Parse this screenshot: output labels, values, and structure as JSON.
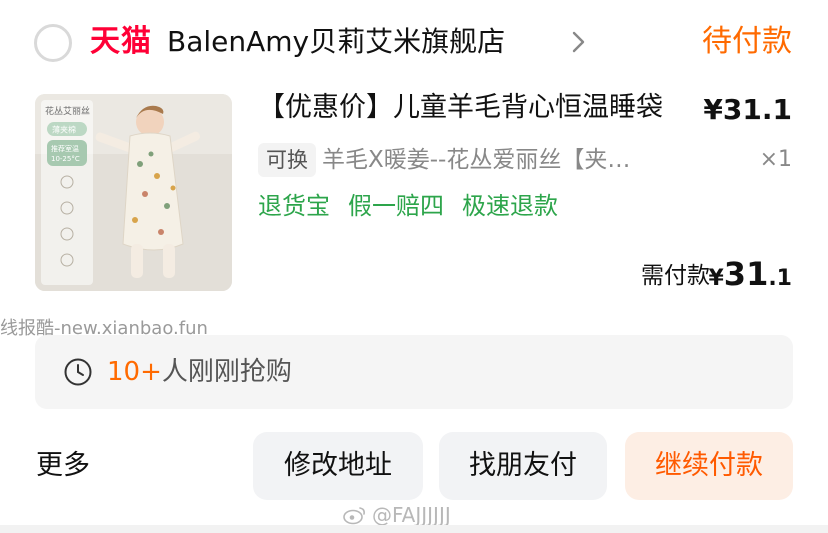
{
  "shop": {
    "platform_logo": "天猫",
    "name": "BalenAmy贝莉艾米旗舰店",
    "status": "待付款"
  },
  "item": {
    "thumbnail": {
      "brand_text": "花丛艾丽丝",
      "badge_text": "薄夹棉",
      "temp_label": "推荐室温",
      "temp_range": "10-25°C"
    },
    "title": "【优惠价】儿童羊毛背心恒温睡袋",
    "price": "¥31.1",
    "exchange_tag": "可换",
    "sku": "羊毛X暖姜--花丛爱丽丝【夹…",
    "quantity": "×1",
    "services": [
      "退货宝",
      "假一赔四",
      "极速退款"
    ],
    "pay_label": "需付款",
    "pay_currency": "¥",
    "pay_integer": "31",
    "pay_decimal": ".1"
  },
  "watermark_top": "线报酷-new.xianbao.fun",
  "buyers": {
    "icon": "clock-icon",
    "highlight": "10+",
    "text": "人刚刚抢购"
  },
  "actions": {
    "more": "更多",
    "modify_address": "修改地址",
    "friend_pay": "找朋友付",
    "continue_pay": "继续付款"
  },
  "watermark_bottom": "@FAJJJJJJ",
  "colors": {
    "brand_red": "#ff0036",
    "status_orange": "#ff6a00",
    "service_green": "#2da54b",
    "pay_button_bg": "#fdeee4"
  }
}
